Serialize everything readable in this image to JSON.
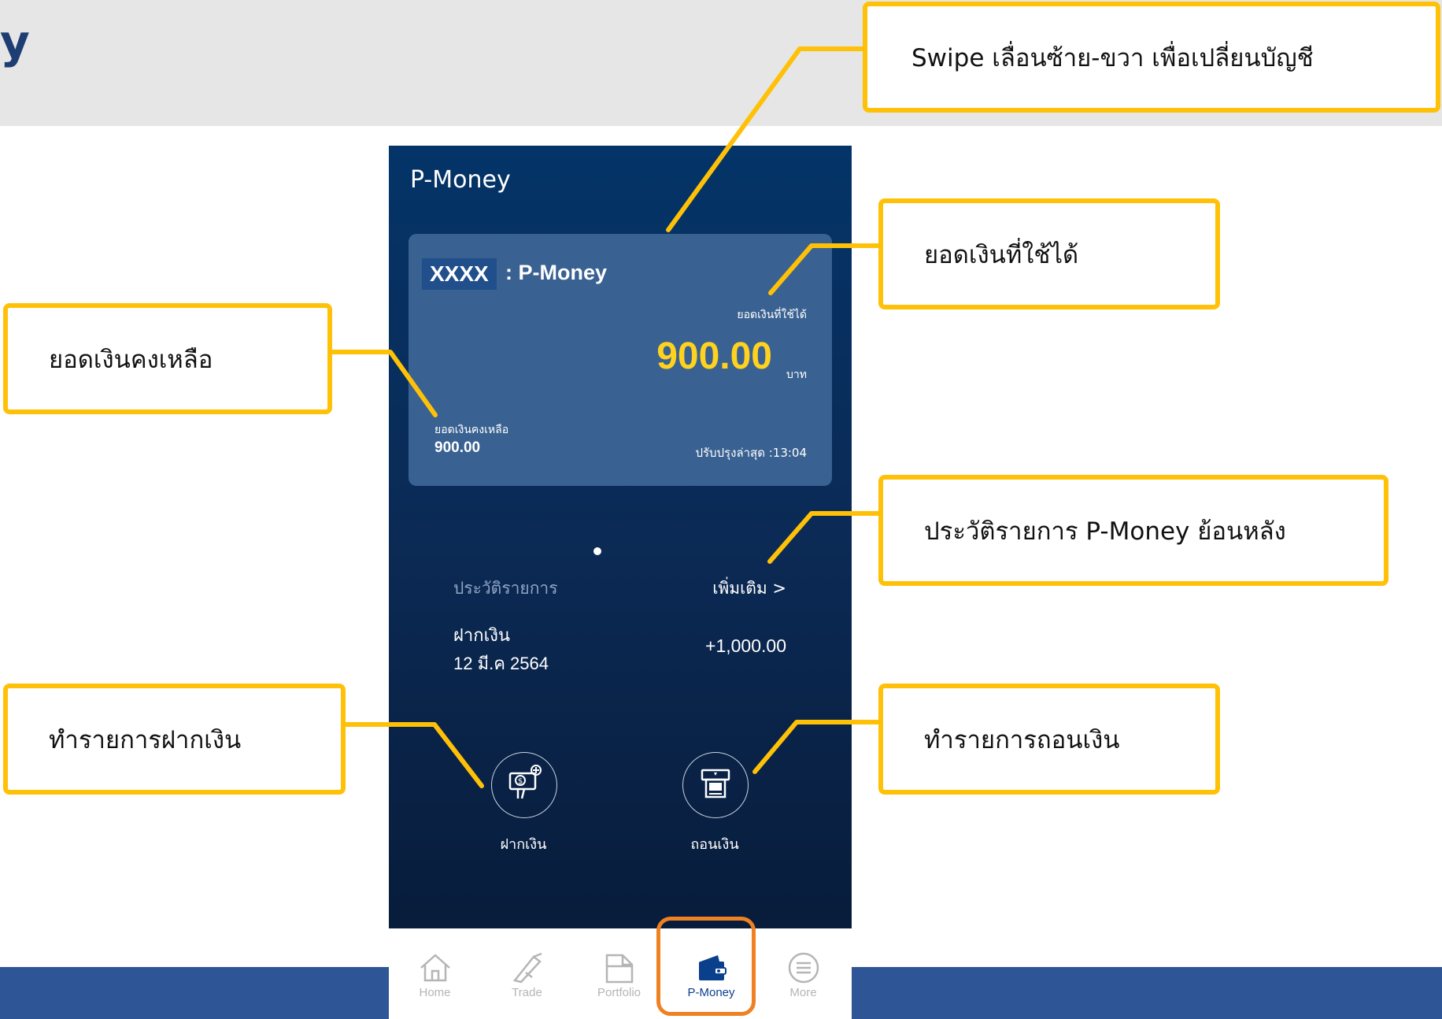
{
  "page": {
    "heading_partial": "y"
  },
  "app": {
    "title": "P-Money",
    "account": {
      "id_masked": "XXXX",
      "name": ": P-Money"
    },
    "available": {
      "label": "ยอดเงินที่ใช้ได้",
      "amount": "900.00",
      "currency": "บาท"
    },
    "balance": {
      "label": "ยอดเงินคงเหลือ",
      "amount": "900.00"
    },
    "last_updated": "ปรับปรุงล่าสุด :13:04",
    "history": {
      "title": "ประวัติรายการ",
      "more": "เพิ่มเติม >",
      "transaction": {
        "type": "ฝากเงิน",
        "date": "12 มี.ค 2564",
        "amount": "+1,000.00"
      }
    },
    "actions": {
      "deposit": "ฝากเงิน",
      "withdraw": "ถอนเงิน"
    },
    "tabs": [
      {
        "label": "Home",
        "icon": "home-icon"
      },
      {
        "label": "Trade",
        "icon": "trade-icon"
      },
      {
        "label": "Portfolio",
        "icon": "portfolio-icon"
      },
      {
        "label": "P-Money",
        "icon": "wallet-icon",
        "active": true
      },
      {
        "label": "More",
        "icon": "more-icon"
      }
    ]
  },
  "callouts": {
    "swipe": "Swipe เลื่อนซ้าย-ขวา เพื่อเปลี่ยนบัญชี",
    "available": "ยอดเงินที่ใช้ได้",
    "balance": "ยอดเงินคงเหลือ",
    "history": "ประวัติรายการ P-Money ย้อนหลัง",
    "deposit": "ทำรายการฝากเงิน",
    "withdraw": "ทำรายการถอนเงิน"
  },
  "colors": {
    "callout_border": "#ffc107",
    "available_amount": "#ffd21f",
    "tab_highlight": "#ef8123",
    "bottom_band": "#2e5596"
  }
}
